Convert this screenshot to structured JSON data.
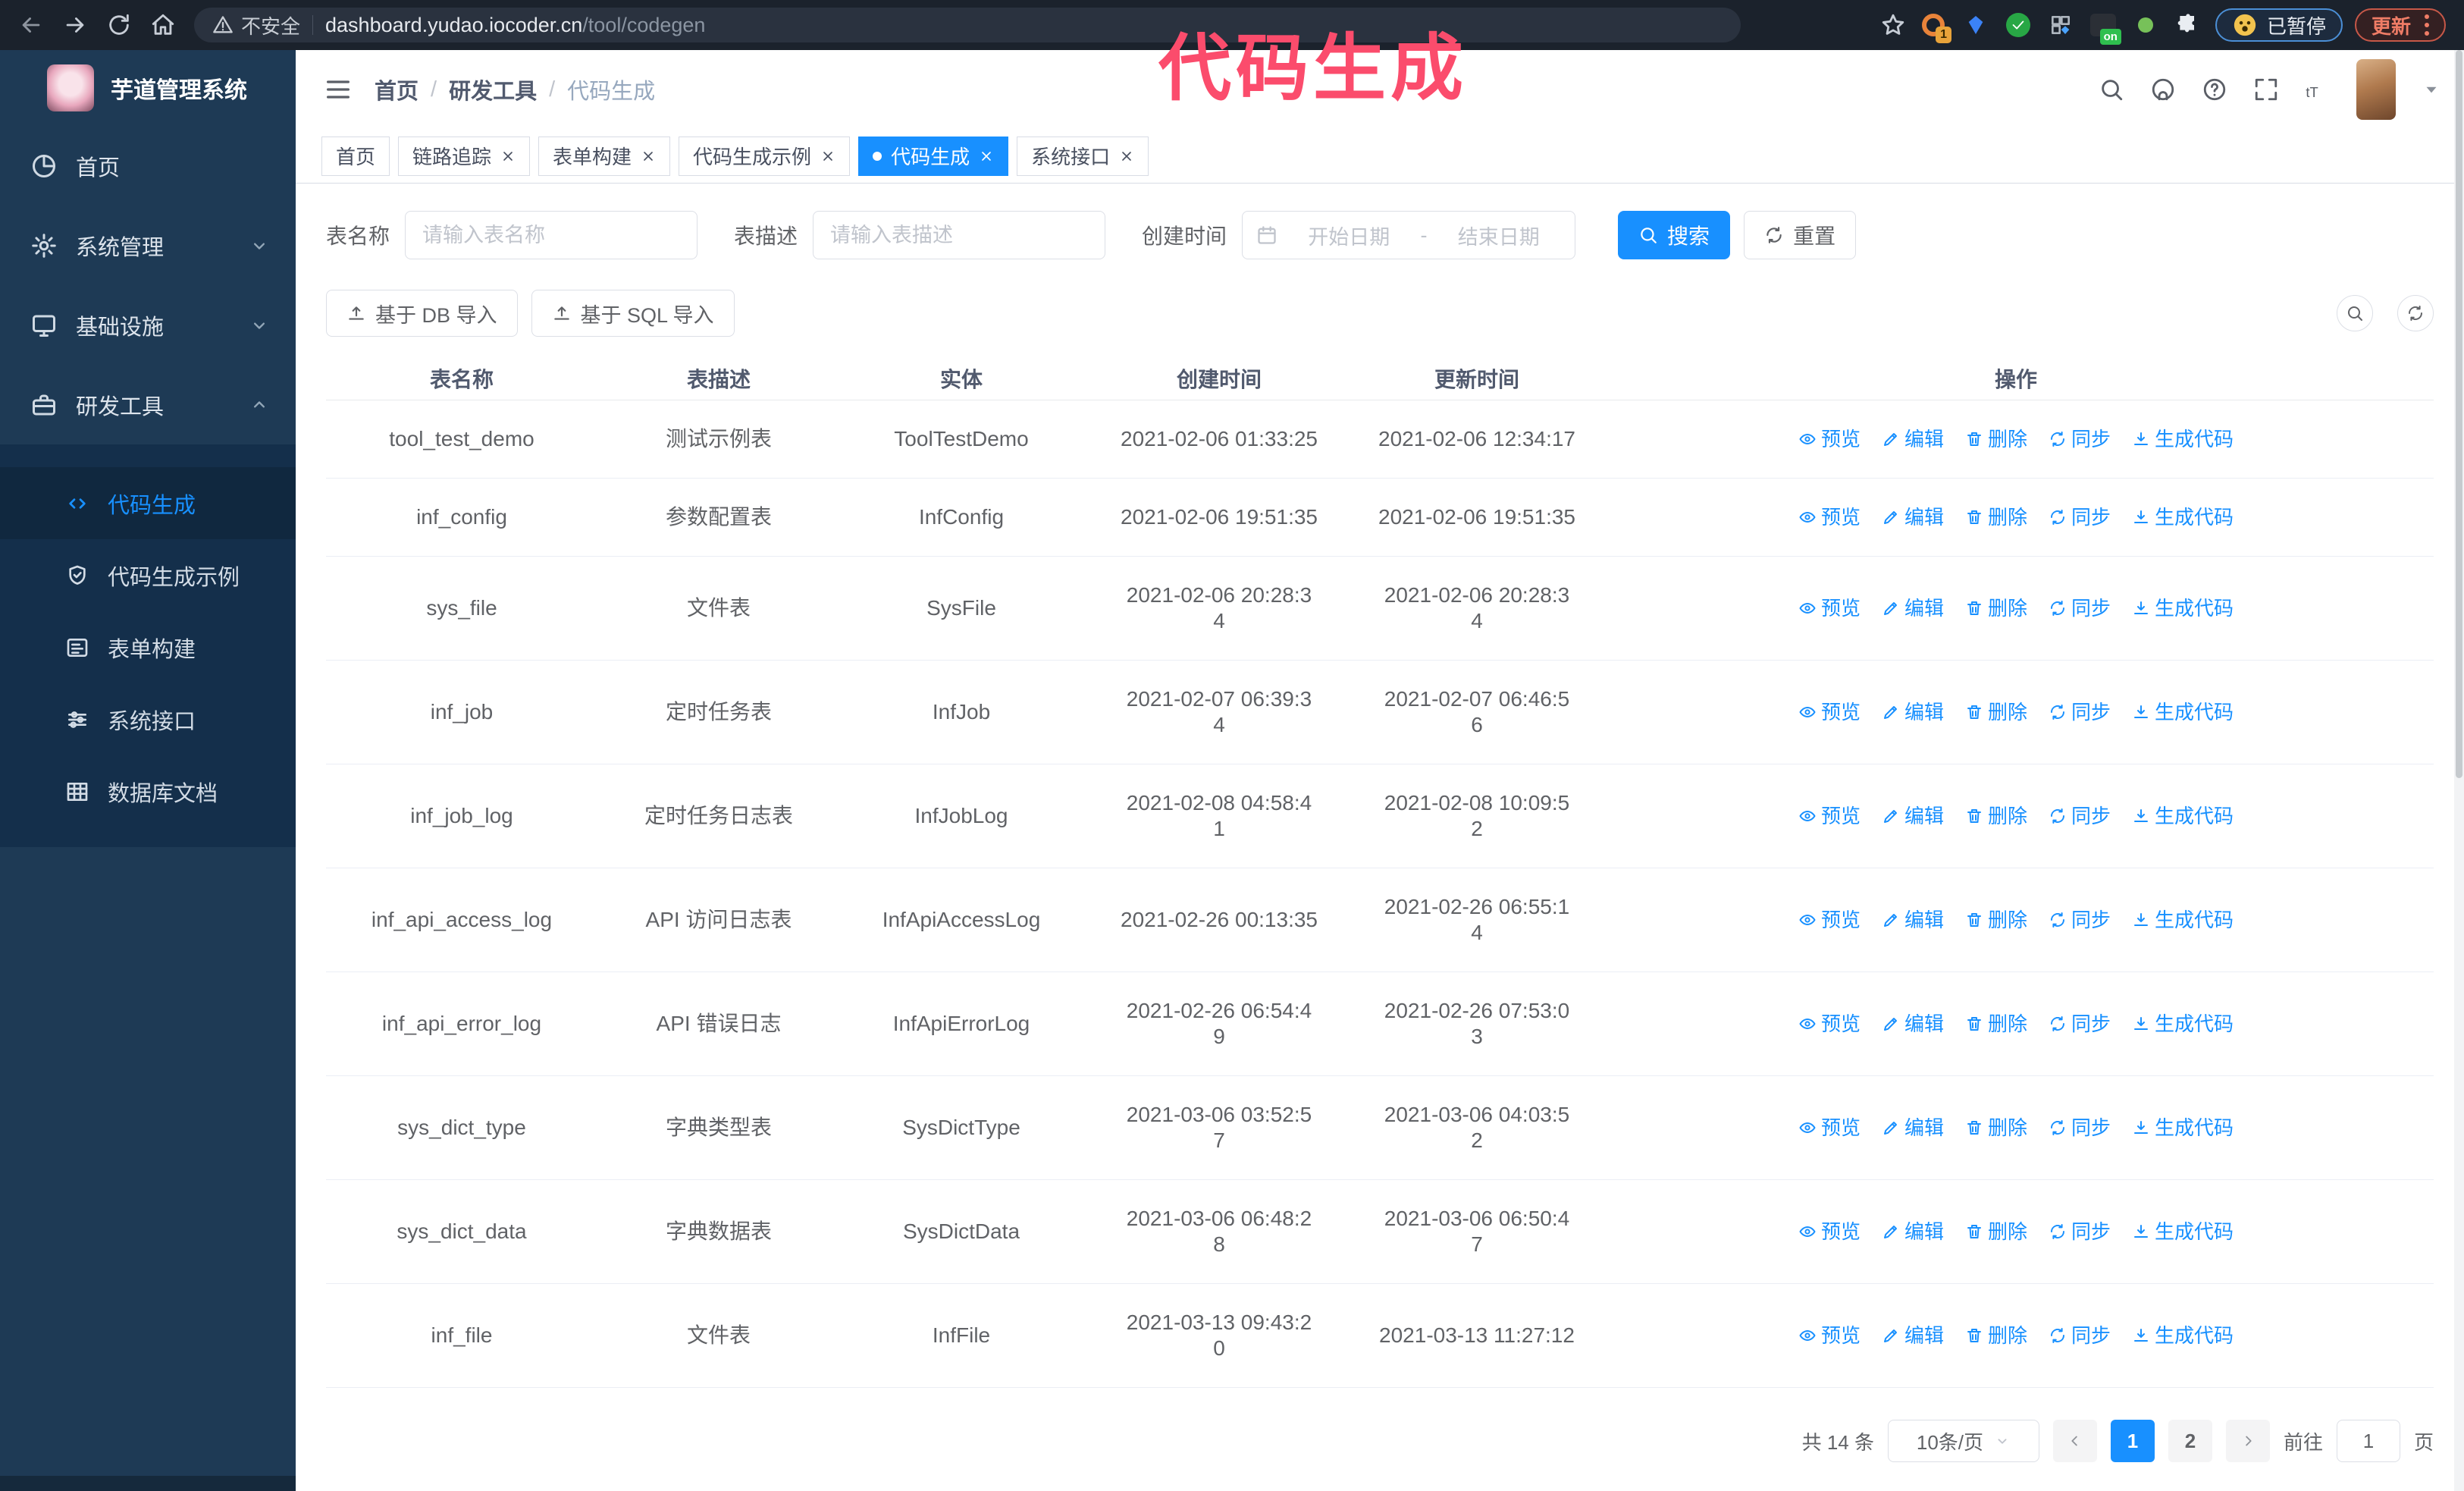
{
  "browser": {
    "security_label": "不安全",
    "url_host": "dashboard.yudao.iocoder.cn",
    "url_path": "/tool/codegen",
    "extension_badge_count": "1",
    "extension_on_badge": "on",
    "paused_badge_label": "已暂停",
    "update_button_label": "更新"
  },
  "annotation": {
    "text": "代码生成",
    "color": "#fb4c6c"
  },
  "sidebar": {
    "title": "芋道管理系统",
    "menu": [
      {
        "label": "首页"
      },
      {
        "label": "系统管理"
      },
      {
        "label": "基础设施"
      },
      {
        "label": "研发工具"
      }
    ],
    "submenu": [
      {
        "label": "代码生成",
        "active": true
      },
      {
        "label": "代码生成示例"
      },
      {
        "label": "表单构建"
      },
      {
        "label": "系统接口"
      },
      {
        "label": "数据库文档"
      }
    ]
  },
  "navbar": {
    "breadcrumb": [
      "首页",
      "研发工具",
      "代码生成"
    ]
  },
  "tags": [
    {
      "label": "首页",
      "active": false,
      "closable": false
    },
    {
      "label": "链路追踪",
      "active": false,
      "closable": true
    },
    {
      "label": "表单构建",
      "active": false,
      "closable": true
    },
    {
      "label": "代码生成示例",
      "active": false,
      "closable": true
    },
    {
      "label": "代码生成",
      "active": true,
      "closable": true
    },
    {
      "label": "系统接口",
      "active": false,
      "closable": true
    }
  ],
  "filters": {
    "table_name_label": "表名称",
    "table_name_placeholder": "请输入表名称",
    "table_desc_label": "表描述",
    "table_desc_placeholder": "请输入表描述",
    "create_time_label": "创建时间",
    "date_start_placeholder": "开始日期",
    "date_separator": "-",
    "date_end_placeholder": "结束日期",
    "search_label": "搜索",
    "reset_label": "重置"
  },
  "toolbar": {
    "import_db_label": "基于 DB 导入",
    "import_sql_label": "基于 SQL 导入"
  },
  "table": {
    "columns": [
      "表名称",
      "表描述",
      "实体",
      "创建时间",
      "更新时间",
      "操作"
    ],
    "actions": [
      "预览",
      "编辑",
      "删除",
      "同步",
      "生成代码"
    ],
    "rows": [
      {
        "name": "tool_test_demo",
        "desc": "测试示例表",
        "entity": "ToolTestDemo",
        "created": "2021-02-06 01:33:25",
        "updated": "2021-02-06 12:34:17",
        "created_wrap": false,
        "updated_wrap": false
      },
      {
        "name": "inf_config",
        "desc": "参数配置表",
        "entity": "InfConfig",
        "created": "2021-02-06 19:51:35",
        "updated": "2021-02-06 19:51:35",
        "created_wrap": false,
        "updated_wrap": false
      },
      {
        "name": "sys_file",
        "desc": "文件表",
        "entity": "SysFile",
        "created": "2021-02-06 20:28:34",
        "updated": "2021-02-06 20:28:34",
        "created_wrap": true,
        "updated_wrap": true
      },
      {
        "name": "inf_job",
        "desc": "定时任务表",
        "entity": "InfJob",
        "created": "2021-02-07 06:39:34",
        "updated": "2021-02-07 06:46:56",
        "created_wrap": true,
        "updated_wrap": true
      },
      {
        "name": "inf_job_log",
        "desc": "定时任务日志表",
        "entity": "InfJobLog",
        "created": "2021-02-08 04:58:41",
        "updated": "2021-02-08 10:09:52",
        "created_wrap": true,
        "updated_wrap": true
      },
      {
        "name": "inf_api_access_log",
        "desc": "API 访问日志表",
        "entity": "InfApiAccessLog",
        "created": "2021-02-26 00:13:35",
        "updated": "2021-02-26 06:55:14",
        "created_wrap": false,
        "updated_wrap": true
      },
      {
        "name": "inf_api_error_log",
        "desc": "API 错误日志",
        "entity": "InfApiErrorLog",
        "created": "2021-02-26 06:54:49",
        "updated": "2021-02-26 07:53:03",
        "created_wrap": true,
        "updated_wrap": true
      },
      {
        "name": "sys_dict_type",
        "desc": "字典类型表",
        "entity": "SysDictType",
        "created": "2021-03-06 03:52:57",
        "updated": "2021-03-06 04:03:52",
        "created_wrap": true,
        "updated_wrap": true
      },
      {
        "name": "sys_dict_data",
        "desc": "字典数据表",
        "entity": "SysDictData",
        "created": "2021-03-06 06:48:28",
        "updated": "2021-03-06 06:50:47",
        "created_wrap": true,
        "updated_wrap": true
      },
      {
        "name": "inf_file",
        "desc": "文件表",
        "entity": "InfFile",
        "created": "2021-03-13 09:43:20",
        "updated": "2021-03-13 11:27:12",
        "created_wrap": true,
        "updated_wrap": false
      }
    ]
  },
  "pagination": {
    "total_label": "共 14 条",
    "page_size_label": "10条/页",
    "pages": [
      "1",
      "2"
    ],
    "active_page": "1",
    "goto_label": "前往",
    "goto_value": "1",
    "unit_label": "页"
  },
  "colors": {
    "accent": "#1890ff",
    "sidebar_bg": "#1e3a55",
    "submenu_bg": "#142f4b",
    "annotation": "#fb4c6c",
    "active_tab_bg": "#1890ff"
  }
}
